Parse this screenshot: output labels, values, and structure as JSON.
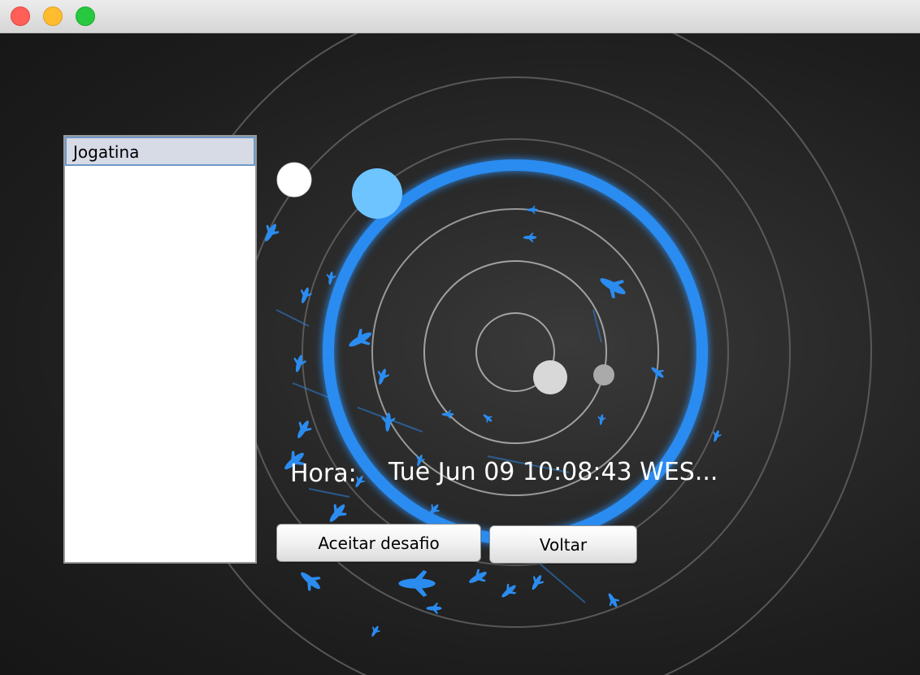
{
  "window": {
    "controls": [
      "close",
      "minimize",
      "maximize"
    ]
  },
  "list": {
    "items": [
      {
        "label": "Jogatina",
        "selected": true
      }
    ]
  },
  "hora": {
    "label": "Hora:",
    "value": "Tue Jun 09 10:08:43 WES..."
  },
  "buttons": {
    "accept_label": "Aceitar desafio",
    "back_label": "Voltar"
  },
  "colors": {
    "accent_blue": "#2b8cf0",
    "selection_bg": "#d7dbe6",
    "selection_border": "#6f99c8"
  }
}
